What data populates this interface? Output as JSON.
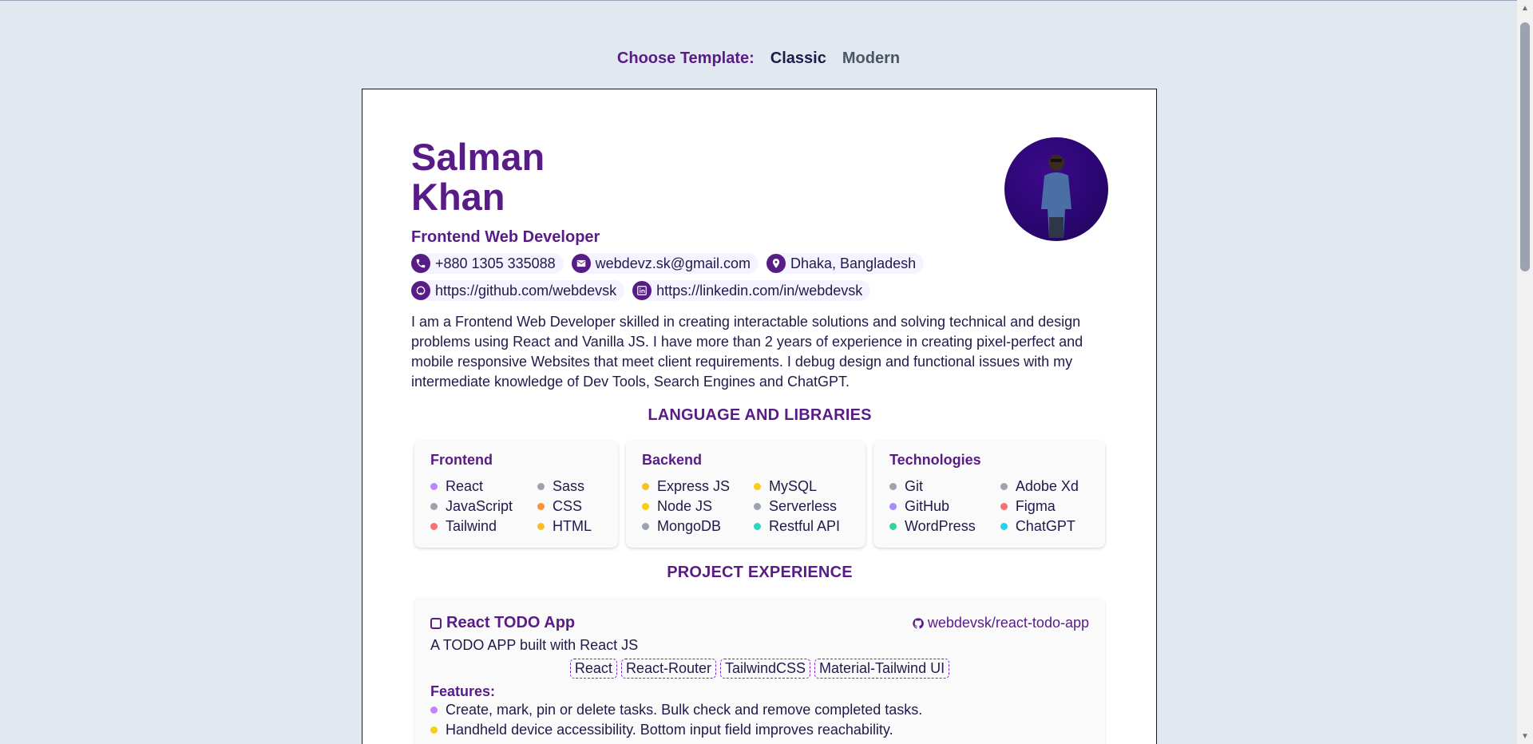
{
  "chooser": {
    "label": "Choose Template:",
    "options": [
      "Classic",
      "Modern"
    ],
    "selected": "Classic"
  },
  "resume": {
    "first_name": "Salman",
    "last_name": "Khan",
    "role": "Frontend Web Developer",
    "contacts": {
      "phone": "+880 1305 335088",
      "email": "webdevz.sk@gmail.com",
      "location": "Dhaka, Bangladesh",
      "github": "https://github.com/webdevsk",
      "linkedin": "https://linkedin.com/in/webdevsk"
    },
    "summary": "I am a Frontend Web Developer skilled in creating interactable solutions and solving technical and design problems using React and Vanilla JS. I have more than 2 years of experience in creating pixel-perfect and mobile responsive Websites that meet client requirements. I debug design and functional issues with my intermediate knowledge of Dev Tools, Search Engines and ChatGPT."
  },
  "skills": {
    "title": "LANGUAGE AND LIBRARIES",
    "groups": [
      {
        "name": "Frontend",
        "items": [
          {
            "label": "React",
            "color": "#c084fc"
          },
          {
            "label": "Sass",
            "color": "#9ca3af"
          },
          {
            "label": "JavaScript",
            "color": "#9ca3af"
          },
          {
            "label": "CSS",
            "color": "#fb923c"
          },
          {
            "label": "Tailwind",
            "color": "#f87171"
          },
          {
            "label": "HTML",
            "color": "#fbbf24"
          }
        ]
      },
      {
        "name": "Backend",
        "items": [
          {
            "label": "Express JS",
            "color": "#fbbf24"
          },
          {
            "label": "MySQL",
            "color": "#facc15"
          },
          {
            "label": "Node JS",
            "color": "#facc15"
          },
          {
            "label": "Serverless",
            "color": "#9ca3af"
          },
          {
            "label": "MongoDB",
            "color": "#9ca3af"
          },
          {
            "label": "Restful API",
            "color": "#2dd4bf"
          }
        ]
      },
      {
        "name": "Technologies",
        "items": [
          {
            "label": "Git",
            "color": "#9ca3af"
          },
          {
            "label": "Adobe Xd",
            "color": "#9ca3af"
          },
          {
            "label": "GitHub",
            "color": "#a78bfa"
          },
          {
            "label": "Figma",
            "color": "#f87171"
          },
          {
            "label": "WordPress",
            "color": "#34d399"
          },
          {
            "label": "ChatGPT",
            "color": "#22d3ee"
          }
        ]
      }
    ]
  },
  "projects": {
    "title": "PROJECT EXPERIENCE",
    "items": [
      {
        "name": "React TODO App",
        "repo": "webdevsk/react-todo-app",
        "description": "A TODO APP built with React JS",
        "tags": [
          "React",
          "React-Router",
          "TailwindCSS",
          "Material-Tailwind UI"
        ],
        "features_label": "Features:",
        "features": [
          {
            "text": "Create, mark, pin or delete tasks. Bulk check and remove completed tasks.",
            "color": "#c084fc"
          },
          {
            "text": "Handheld device accessibility. Bottom input field improves reachability.",
            "color": "#facc15"
          }
        ]
      }
    ]
  }
}
